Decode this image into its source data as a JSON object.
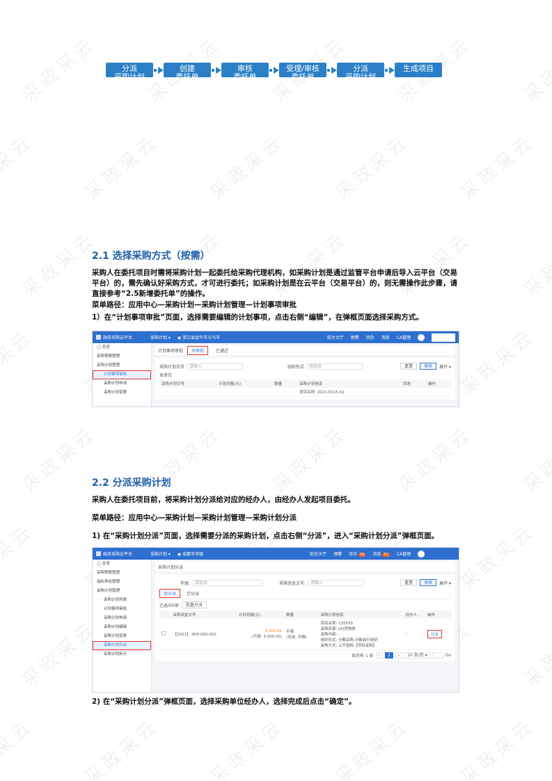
{
  "flow": {
    "steps": [
      {
        "line1": "分派",
        "line2": "采购计划"
      },
      {
        "line1": "创建",
        "line2": "委托单"
      },
      {
        "line1": "审核",
        "line2": "委托单"
      },
      {
        "line1": "受理/审核",
        "line2": "委托单"
      },
      {
        "line1": "分派",
        "line2": "采购计划"
      },
      {
        "line1": "生成项目",
        "line2": ""
      }
    ]
  },
  "watermark": "采政采云",
  "section1": {
    "title": "2.1 选择采购方式（按需）",
    "p1": "采购人在委托项目时需将采购计划一起委托给采购代理机构，如采购计划是通过监管平台申请后导入云平台（交易平台）的，需先确认好采购方式，才可进行委托；如采购计划是在云平台（交易平台）的，则无需操作此步骤，请直接参考“2.5新增委托单”的操作。",
    "menu_path": "菜单路径：应用中心—采购计划—采购计划管理—计划事项审批",
    "step1": "1）在“计划事项审批”页面，选择需要编辑的计划事项，点击右侧“编辑”，在弹框页面选择采购方式。"
  },
  "shot1": {
    "app": "政府采购云平台",
    "nav": [
      "采购计划 ▾",
      "◉ 浙江省金华市义乌市"
    ],
    "right": [
      "前台大厅",
      "预警",
      "待办",
      "消息",
      "CA管理"
    ],
    "sidebar": [
      {
        "label": "◯ 总览",
        "sub": false
      },
      {
        "label": "采购预算管理",
        "sub": false
      },
      {
        "label": "采购计划管理",
        "sub": false
      },
      {
        "label": "计划事项审批",
        "sub": true,
        "active": true
      },
      {
        "label": "采购计划申请",
        "sub": true
      },
      {
        "label": "采购计划变更",
        "sub": true
      }
    ],
    "page_title": "计划事项审批",
    "tabs": [
      "待审批",
      "已通过"
    ],
    "filter_label1": "采购计划文号",
    "filter_ph1": "请输入",
    "filter_label2": "组织形式",
    "filter_ph2": "请选择",
    "reset": "重置",
    "search": "搜索",
    "expand": "展开 ▾",
    "unit": "本单位",
    "columns": [
      "采购计划文号",
      "计划总额(元)",
      "数量",
      "采购计划信息",
      "状态",
      "操作"
    ],
    "row_info": "项目名称: 2021-0115-02"
  },
  "section2": {
    "title": "2.2 分派采购计划",
    "p1": "采购人在委托项目前，将采购计划分派给对应的经办人，由经办人发起项目委托。",
    "menu_path": "菜单路径：应用中心—采购计划—采购计划管理—采购计划分派",
    "step1": "1) 在“采购计划分派”页面，选择需要分派的采购计划，点击右侧“分派”，进入“采购计划分派”弹框页面。",
    "step2": "2) 在“采购计划分派”弹框页面，选择采购单位经办人，选择完成后点击“确定”。"
  },
  "shot2": {
    "app": "政府采购云平台",
    "nav": [
      "采购计划 ▾",
      "◉ 成都市市级"
    ],
    "right": [
      "前台大厅",
      "预警",
      "待办",
      "消息",
      "CA管理"
    ],
    "badge1": "99",
    "badge2": "61",
    "sidebar": [
      {
        "label": "◯ 总览",
        "sub": false
      },
      {
        "label": "采购预算管理",
        "sub": false
      },
      {
        "label": "指标来检管理",
        "sub": false
      },
      {
        "label": "采购计划管理",
        "sub": false
      },
      {
        "label": "采购计划列表",
        "sub": true
      },
      {
        "label": "计划事项审批",
        "sub": true
      },
      {
        "label": "采购计划申请",
        "sub": true
      },
      {
        "label": "采购计划编辑",
        "sub": true
      },
      {
        "label": "采购计划变更",
        "sub": true
      },
      {
        "label": "采购计划分派",
        "sub": true,
        "active": true
      },
      {
        "label": "采购计划拆分",
        "sub": true
      }
    ],
    "page_title": "采购计划分派",
    "filter_label1": "年度:",
    "filter_ph1": "请选择",
    "filter_label2": "采购资金文号:",
    "filter_ph2": "请输入",
    "reset": "重置",
    "search": "搜索",
    "expand": "展开 ▾",
    "tabs": [
      "待分派",
      "已分派"
    ],
    "selected": "已选中0项",
    "batch": "批量分派",
    "columns": [
      "",
      "采购资金文号",
      "计划总额(元)",
      "数量",
      "采购计划信息",
      "经办人",
      "操作"
    ],
    "row": {
      "code": "【2021】-005-002-002",
      "amount": "3,000.00",
      "amount_sub": "(可用: 3,000.00)",
      "qty": "不限",
      "qty_sub": "(可用: 不限)",
      "info": [
        "项目名称: 135555",
        "采购目录: [A]货物类",
        "采购内容: -",
        "组织形式: 分散采购-分散自行组织",
        "采购方式: 公开招标【项目采购】"
      ],
      "handler": "-",
      "op": "分派"
    },
    "pager": {
      "total": "共内有 1 条",
      "prev": "‹",
      "page": "1",
      "next": "›",
      "size": "10 条/页 ▾",
      "goto": "Go"
    }
  }
}
